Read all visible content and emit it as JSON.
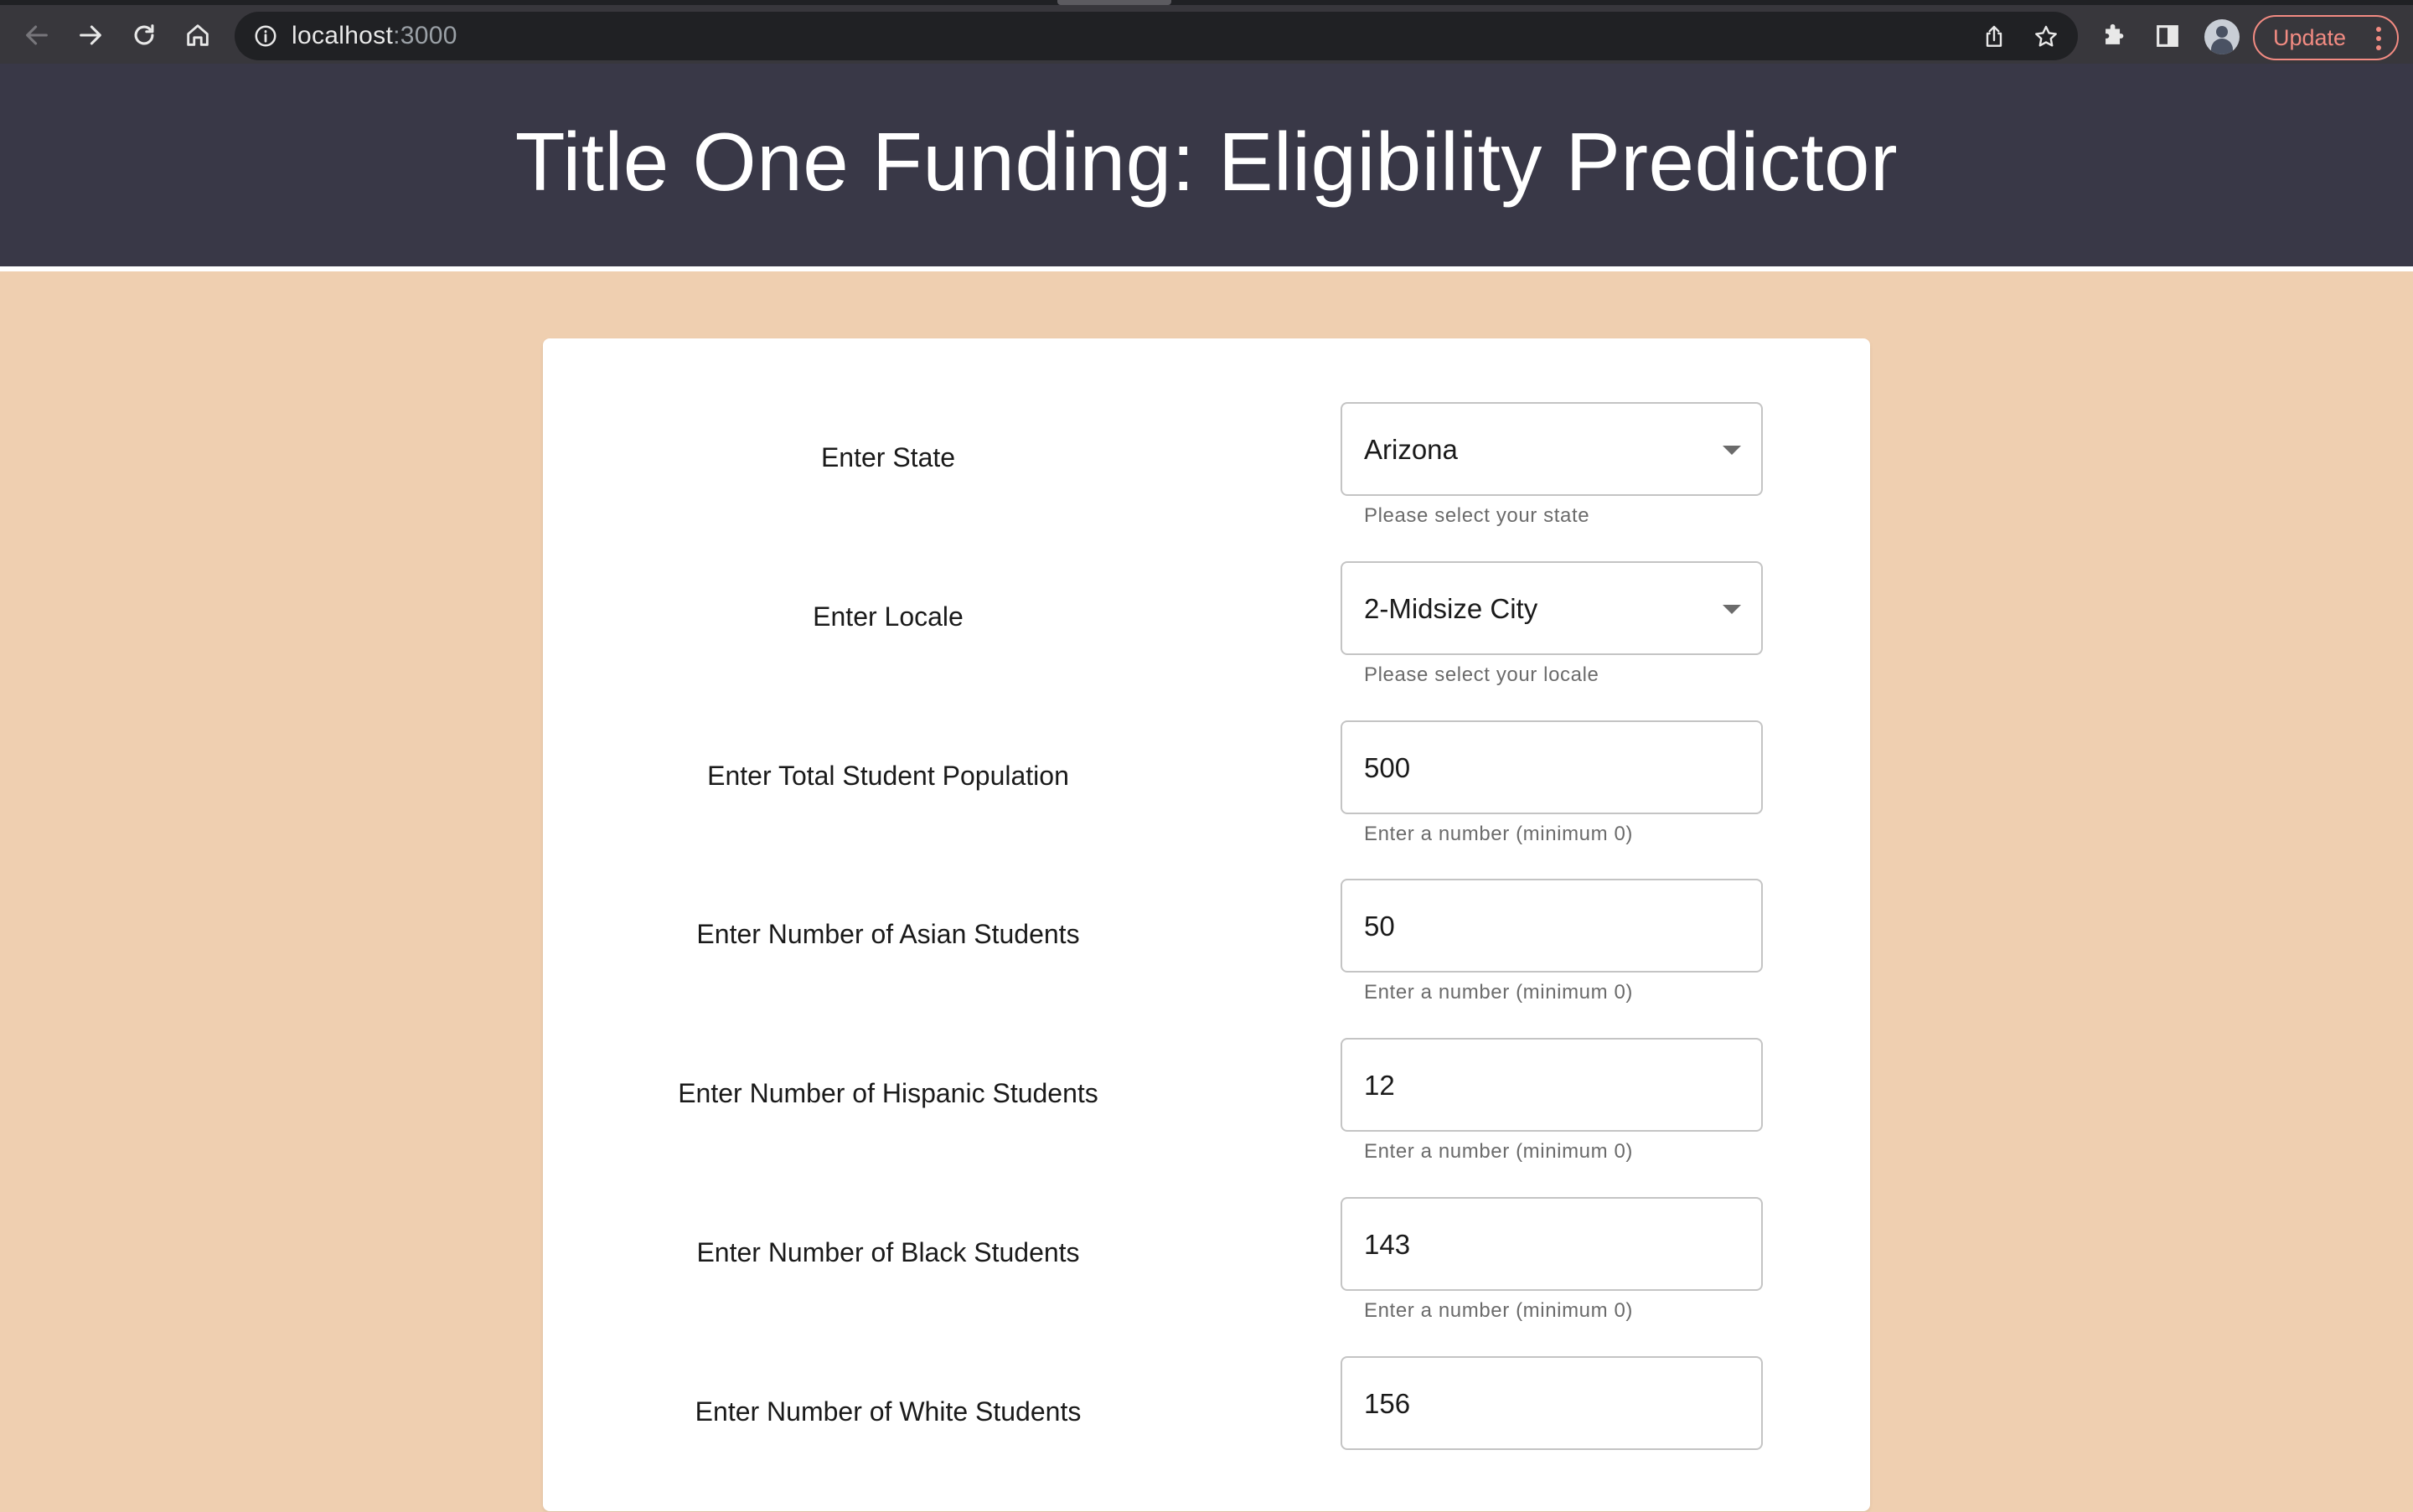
{
  "browser": {
    "url_host": "localhost",
    "url_port": ":3000",
    "update_label": "Update"
  },
  "header": {
    "title": "Title One Funding: Eligibility Predictor"
  },
  "form": {
    "fields": [
      {
        "label": "Enter State",
        "value": "Arizona",
        "helper": "Please select your state",
        "type": "select"
      },
      {
        "label": "Enter Locale",
        "value": "2-Midsize City",
        "helper": "Please select your locale",
        "type": "select"
      },
      {
        "label": "Enter Total Student Population",
        "value": "500",
        "helper": "Enter a number (minimum 0)",
        "type": "number"
      },
      {
        "label": "Enter Number of Asian Students",
        "value": "50",
        "helper": "Enter a number (minimum 0)",
        "type": "number"
      },
      {
        "label": "Enter Number of Hispanic Students",
        "value": "12",
        "helper": "Enter a number (minimum 0)",
        "type": "number"
      },
      {
        "label": "Enter Number of Black Students",
        "value": "143",
        "helper": "Enter a number (minimum 0)",
        "type": "number"
      },
      {
        "label": "Enter Number of White Students",
        "value": "156",
        "helper": "",
        "type": "number"
      }
    ]
  },
  "colors": {
    "page_bg": "#efcfb0",
    "header_bg": "#393847",
    "card_bg": "#ffffff",
    "update_accent": "#f28b82"
  }
}
